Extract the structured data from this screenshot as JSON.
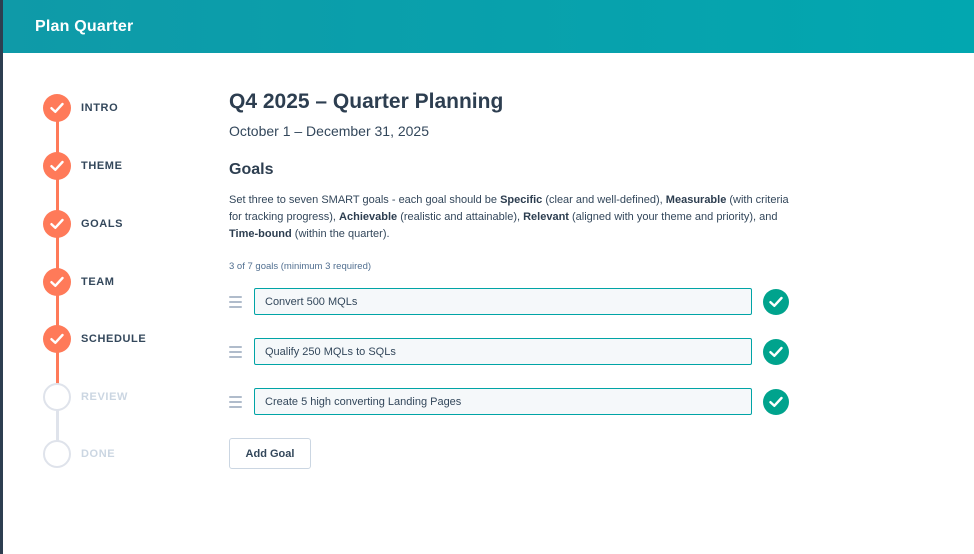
{
  "header": {
    "title": "Plan Quarter"
  },
  "stepper": {
    "steps": [
      {
        "label": "INTRO",
        "status": "done"
      },
      {
        "label": "THEME",
        "status": "done"
      },
      {
        "label": "GOALS",
        "status": "done"
      },
      {
        "label": "TEAM",
        "status": "done"
      },
      {
        "label": "SCHEDULE",
        "status": "done"
      },
      {
        "label": "REVIEW",
        "status": "pending"
      },
      {
        "label": "DONE",
        "status": "pending"
      }
    ]
  },
  "main": {
    "title": "Q4 2025 – Quarter Planning",
    "dates": "October 1 – December 31, 2025",
    "goals_heading": "Goals",
    "description": {
      "intro": "Set three to seven SMART goals - each goal should be ",
      "specific": "Specific",
      "specific_desc": " (clear and well-defined), ",
      "measurable": "Measurable",
      "measurable_desc": " (with criteria for tracking progress), ",
      "achievable": "Achievable",
      "achievable_desc": " (realistic and attainable), ",
      "relevant": "Relevant",
      "relevant_desc": " (aligned with your theme and priority), and ",
      "time_bound": "Time-bound",
      "time_bound_desc": " (within the quarter)."
    },
    "counter": "3 of 7 goals (minimum 3 required)",
    "goals": [
      {
        "value": "Convert 500 MQLs"
      },
      {
        "value": "Qualify 250 MQLs to SQLs"
      },
      {
        "value": "Create 5 high converting Landing Pages"
      }
    ],
    "add_goal_label": "Add Goal"
  },
  "colors": {
    "header_gradient_start": "#0f9aa8",
    "header_gradient_end": "#02a7b0",
    "step_done": "#ff7a59",
    "step_pending": "#dfe3eb",
    "check_badge": "#00a38d",
    "input_border": "#00a4a6"
  },
  "icons": {
    "step_done": "checkmark-icon",
    "goal_valid": "check-circle-icon",
    "drag": "drag-handle-icon"
  }
}
